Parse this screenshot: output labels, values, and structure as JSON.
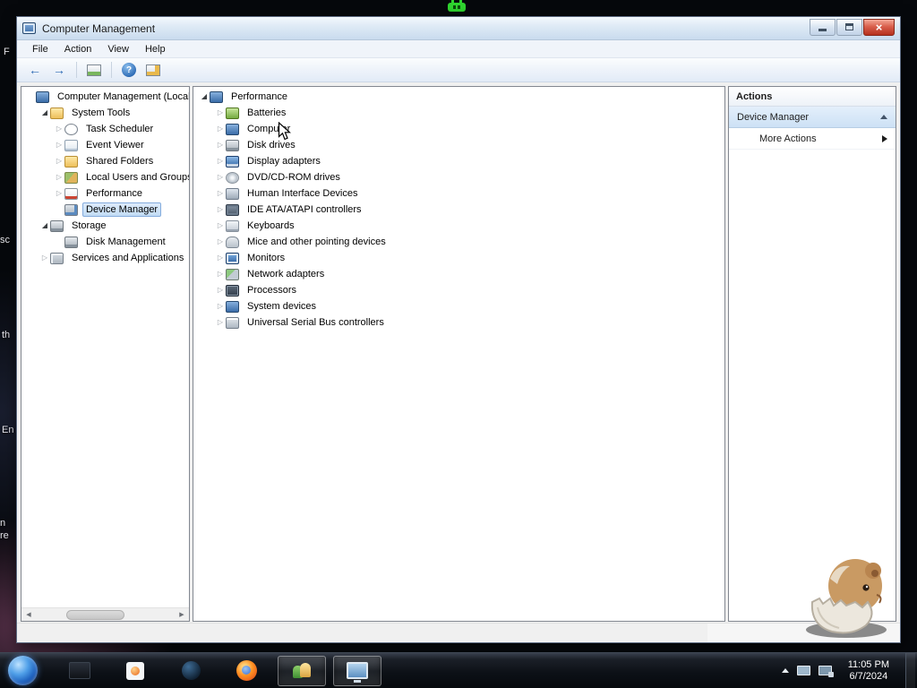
{
  "colors": {
    "selection_blue": "#c2dcf5",
    "actions_highlight": "#cde1f5",
    "close_button_red": "#b5301e",
    "taskbar_dark": "#0d1117",
    "title_bar_blue": "#c9dbee"
  },
  "desktop": {
    "fragments": [
      "F",
      "sc",
      "th",
      "En",
      "n",
      "re"
    ],
    "taskbar": {
      "time": "11:05 PM",
      "date": "6/7/2024"
    }
  },
  "window": {
    "title": "Computer Management",
    "menu": [
      "File",
      "Action",
      "View",
      "Help"
    ],
    "left_tree": {
      "items": [
        {
          "label": "Computer Management (Local",
          "indent": 0,
          "icon": "computer-management",
          "state": "none",
          "selected": false
        },
        {
          "label": "System Tools",
          "indent": 1,
          "icon": "system-tools",
          "state": "expanded",
          "selected": false
        },
        {
          "label": "Task Scheduler",
          "indent": 2,
          "icon": "task-scheduler",
          "state": "collapsed",
          "selected": false
        },
        {
          "label": "Event Viewer",
          "indent": 2,
          "icon": "event-viewer",
          "state": "collapsed",
          "selected": false
        },
        {
          "label": "Shared Folders",
          "indent": 2,
          "icon": "shared-folders",
          "state": "collapsed",
          "selected": false
        },
        {
          "label": "Local Users and Groups",
          "indent": 2,
          "icon": "local-users",
          "state": "collapsed",
          "selected": false
        },
        {
          "label": "Performance",
          "indent": 2,
          "icon": "performance",
          "state": "collapsed",
          "selected": false
        },
        {
          "label": "Device Manager",
          "indent": 2,
          "icon": "device-manager",
          "state": "none",
          "selected": true
        },
        {
          "label": "Storage",
          "indent": 1,
          "icon": "storage",
          "state": "expanded",
          "selected": false
        },
        {
          "label": "Disk Management",
          "indent": 2,
          "icon": "disk-management",
          "state": "none",
          "selected": false
        },
        {
          "label": "Services and Applications",
          "indent": 1,
          "icon": "services",
          "state": "collapsed",
          "selected": false
        }
      ]
    },
    "device_tree": {
      "items": [
        {
          "label": "Performance",
          "indent": 0,
          "icon": "dm-root",
          "state": "expanded",
          "selected": false
        },
        {
          "label": "Batteries",
          "indent": 1,
          "icon": "dm-batteries",
          "state": "collapsed",
          "selected": false
        },
        {
          "label": "Computer",
          "indent": 1,
          "icon": "dm-computer",
          "state": "collapsed",
          "selected": false
        },
        {
          "label": "Disk drives",
          "indent": 1,
          "icon": "dm-disk",
          "state": "collapsed",
          "selected": false
        },
        {
          "label": "Display adapters",
          "indent": 1,
          "icon": "dm-display",
          "state": "collapsed",
          "selected": false
        },
        {
          "label": "DVD/CD-ROM drives",
          "indent": 1,
          "icon": "dm-dvd",
          "state": "collapsed",
          "selected": false
        },
        {
          "label": "Human Interface Devices",
          "indent": 1,
          "icon": "dm-hid",
          "state": "collapsed",
          "selected": false
        },
        {
          "label": "IDE ATA/ATAPI controllers",
          "indent": 1,
          "icon": "dm-ide",
          "state": "collapsed",
          "selected": false
        },
        {
          "label": "Keyboards",
          "indent": 1,
          "icon": "dm-keyboard",
          "state": "collapsed",
          "selected": false
        },
        {
          "label": "Mice and other pointing devices",
          "indent": 1,
          "icon": "dm-mouse",
          "state": "collapsed",
          "selected": false
        },
        {
          "label": "Monitors",
          "indent": 1,
          "icon": "dm-monitor",
          "state": "collapsed",
          "selected": false
        },
        {
          "label": "Network adapters",
          "indent": 1,
          "icon": "dm-network",
          "state": "collapsed",
          "selected": false
        },
        {
          "label": "Processors",
          "indent": 1,
          "icon": "dm-processor",
          "state": "collapsed",
          "selected": false
        },
        {
          "label": "System devices",
          "indent": 1,
          "icon": "dm-system",
          "state": "collapsed",
          "selected": false
        },
        {
          "label": "Universal Serial Bus controllers",
          "indent": 1,
          "icon": "dm-usb",
          "state": "collapsed",
          "selected": false
        }
      ]
    },
    "actions": {
      "header": "Actions",
      "device_manager": "Device Manager",
      "more_actions": "More Actions"
    }
  }
}
